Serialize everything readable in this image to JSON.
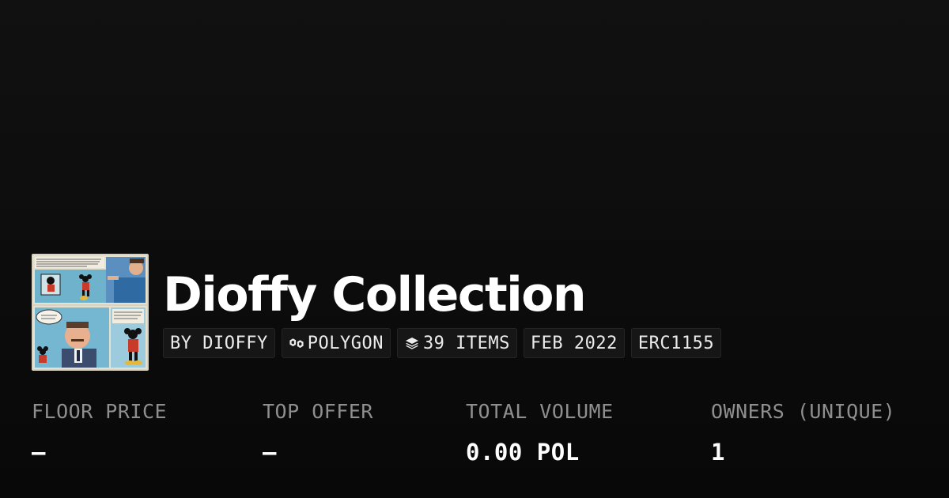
{
  "collection": {
    "title": "Dioffy Collection",
    "thumbnail_icon": "comic-strip-thumbnail"
  },
  "chips": {
    "creator": "BY DIOFFY",
    "chain": "POLYGON",
    "chain_icon": "polygon-link-icon",
    "items": "39 ITEMS",
    "items_icon": "layers-icon",
    "date": "FEB 2022",
    "standard": "ERC1155"
  },
  "stats": {
    "floor_price": {
      "label": "FLOOR PRICE",
      "value": "—"
    },
    "top_offer": {
      "label": "TOP OFFER",
      "value": "—"
    },
    "total_volume": {
      "label": "TOTAL VOLUME",
      "value": "0.00 POL"
    },
    "owners": {
      "label": "OWNERS (UNIQUE)",
      "value": "1"
    }
  },
  "colors": {
    "background": "#0b0b0b",
    "chip_background": "#161616",
    "label_gray": "#8f8f8f",
    "text_white": "#ffffff"
  }
}
